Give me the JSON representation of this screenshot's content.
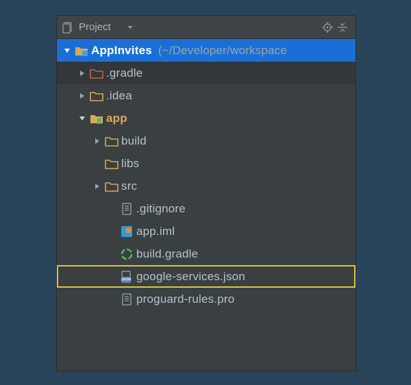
{
  "toolbar": {
    "title": "Project"
  },
  "tree": {
    "root": {
      "name": "AppInvites",
      "path": "(~/Developer/workspace"
    },
    "items": [
      {
        "name": ".gradle"
      },
      {
        "name": ".idea"
      },
      {
        "name": "app"
      },
      {
        "name": "build"
      },
      {
        "name": "libs"
      },
      {
        "name": "src"
      },
      {
        "name": ".gitignore"
      },
      {
        "name": "app.iml"
      },
      {
        "name": "build.gradle"
      },
      {
        "name": "google-services.json"
      },
      {
        "name": "proguard-rules.pro"
      }
    ]
  }
}
